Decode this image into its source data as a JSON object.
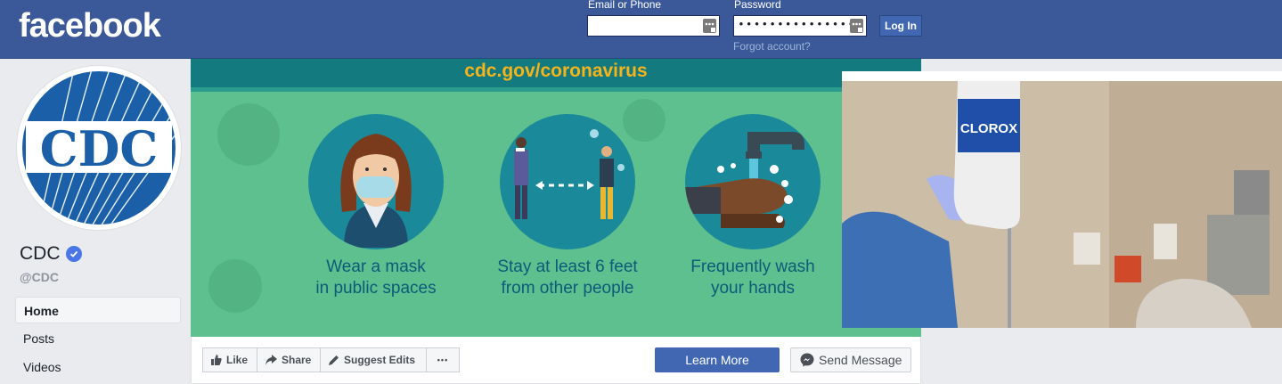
{
  "header": {
    "logo": "facebook",
    "email_label": "Email or Phone",
    "email_value": "",
    "password_label": "Password",
    "password_value": "••••••••••••••••",
    "login_label": "Log In",
    "forgot_label": "Forgot account?"
  },
  "profile": {
    "logo_text": "CDC",
    "name": "CDC",
    "verified": true,
    "handle": "@CDC"
  },
  "nav": {
    "items": [
      {
        "label": "Home",
        "active": true
      },
      {
        "label": "Posts",
        "active": false
      },
      {
        "label": "Videos",
        "active": false
      }
    ]
  },
  "cover": {
    "url": "cdc.gov/coronavirus",
    "tips": [
      {
        "text": "Wear a mask\nin public spaces"
      },
      {
        "text": "Stay at least 6 feet\nfrom other people"
      },
      {
        "text": "Frequently wash\nyour hands"
      }
    ]
  },
  "photo": {
    "bottle_label": "CLOROX"
  },
  "actions": {
    "like": "Like",
    "share": "Share",
    "suggest": "Suggest Edits",
    "more": "•••",
    "learn_more": "Learn More",
    "send_message": "Send Message"
  },
  "colors": {
    "brand": "#3b5998",
    "button": "#4267b2",
    "cover_green": "#5ec08e",
    "cover_teal": "#137a80",
    "cover_url": "#f4b41a",
    "verified": "#4a76e8"
  }
}
